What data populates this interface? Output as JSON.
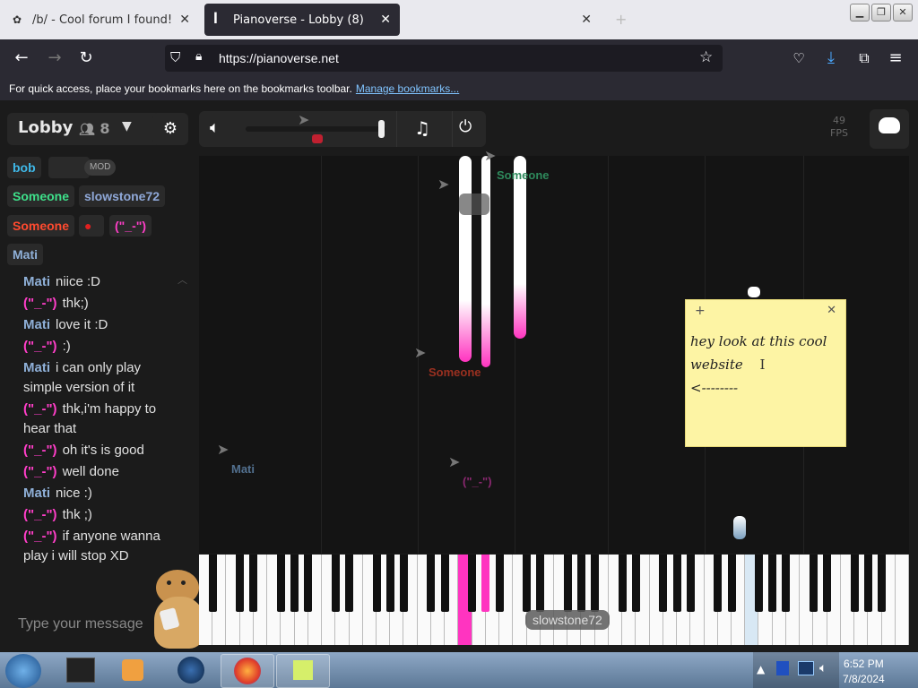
{
  "browser": {
    "tabs": [
      {
        "label": "/b/ - Cool forum I found! - Ran"
      },
      {
        "label": "Pianoverse - Lobby (8)"
      },
      {
        "label": ""
      }
    ],
    "url": "https://pianoverse.net",
    "bookmarks_text": "For quick access, place your bookmarks here on the bookmarks toolbar.",
    "bookmarks_link": "Manage bookmarks..."
  },
  "app": {
    "room_title": "Lobby",
    "user_count": "8",
    "fps_value": "49",
    "fps_label": "FPS"
  },
  "users": [
    {
      "name": "bob",
      "color": "#3fb8e8"
    },
    {
      "name": "Someone",
      "color": "#3ee08a"
    },
    {
      "name": "slowstone72",
      "color": "#8fa8d8"
    },
    {
      "name": "Someone",
      "color": "#ff4a2f"
    },
    {
      "name": "(\"_-\")",
      "color": "#ff3ec8"
    },
    {
      "name": "Mati",
      "color": "#8fb0d8"
    }
  ],
  "mod_badge": "MOD",
  "chat": [
    {
      "who": "Mati",
      "text": "niice :D",
      "color": "#8fb0d8"
    },
    {
      "who": "(\"_-\")",
      "text": "thk;)",
      "color": "#ff3ec8"
    },
    {
      "who": "Mati",
      "text": "love it :D",
      "color": "#8fb0d8"
    },
    {
      "who": "(\"_-\")",
      "text": ":)",
      "color": "#ff3ec8"
    },
    {
      "who": "Mati",
      "text": "i can only play simple version of it",
      "color": "#8fb0d8"
    },
    {
      "who": "(\"_-\")",
      "text": "thk,i'm happy to hear that",
      "color": "#ff3ec8"
    },
    {
      "who": "(\"_-\")",
      "text": "oh it's is good",
      "color": "#ff3ec8"
    },
    {
      "who": "(\"_-\")",
      "text": "well done",
      "color": "#ff3ec8"
    },
    {
      "who": "Mati",
      "text": "nice :)",
      "color": "#8fb0d8"
    },
    {
      "who": "(\"_-\")",
      "text": "thk ;)",
      "color": "#ff3ec8"
    },
    {
      "who": "(\"_-\")",
      "text": "if anyone wanna play i will stop XD",
      "color": "#ff3ec8"
    }
  ],
  "chat_placeholder": "Type your message",
  "cursors": [
    {
      "label": "Someone",
      "color": "#2e8a5c"
    },
    {
      "label": "Someone",
      "color": "#9a3020"
    },
    {
      "label": "Mati",
      "color": "#52708f"
    },
    {
      "label": "(\"_-\")",
      "color": "#8a2870"
    },
    {
      "label": "slowstone72",
      "color": "#dddddd"
    }
  ],
  "sticky_note": {
    "line1": "hey look at this cool",
    "line2": "website",
    "line3": "<--------"
  },
  "taskbar": {
    "time": "6:52 PM",
    "date": "7/8/2024"
  },
  "colors": {
    "accent_pink": "#ff34c0",
    "page_bg": "#1b1b1b"
  }
}
